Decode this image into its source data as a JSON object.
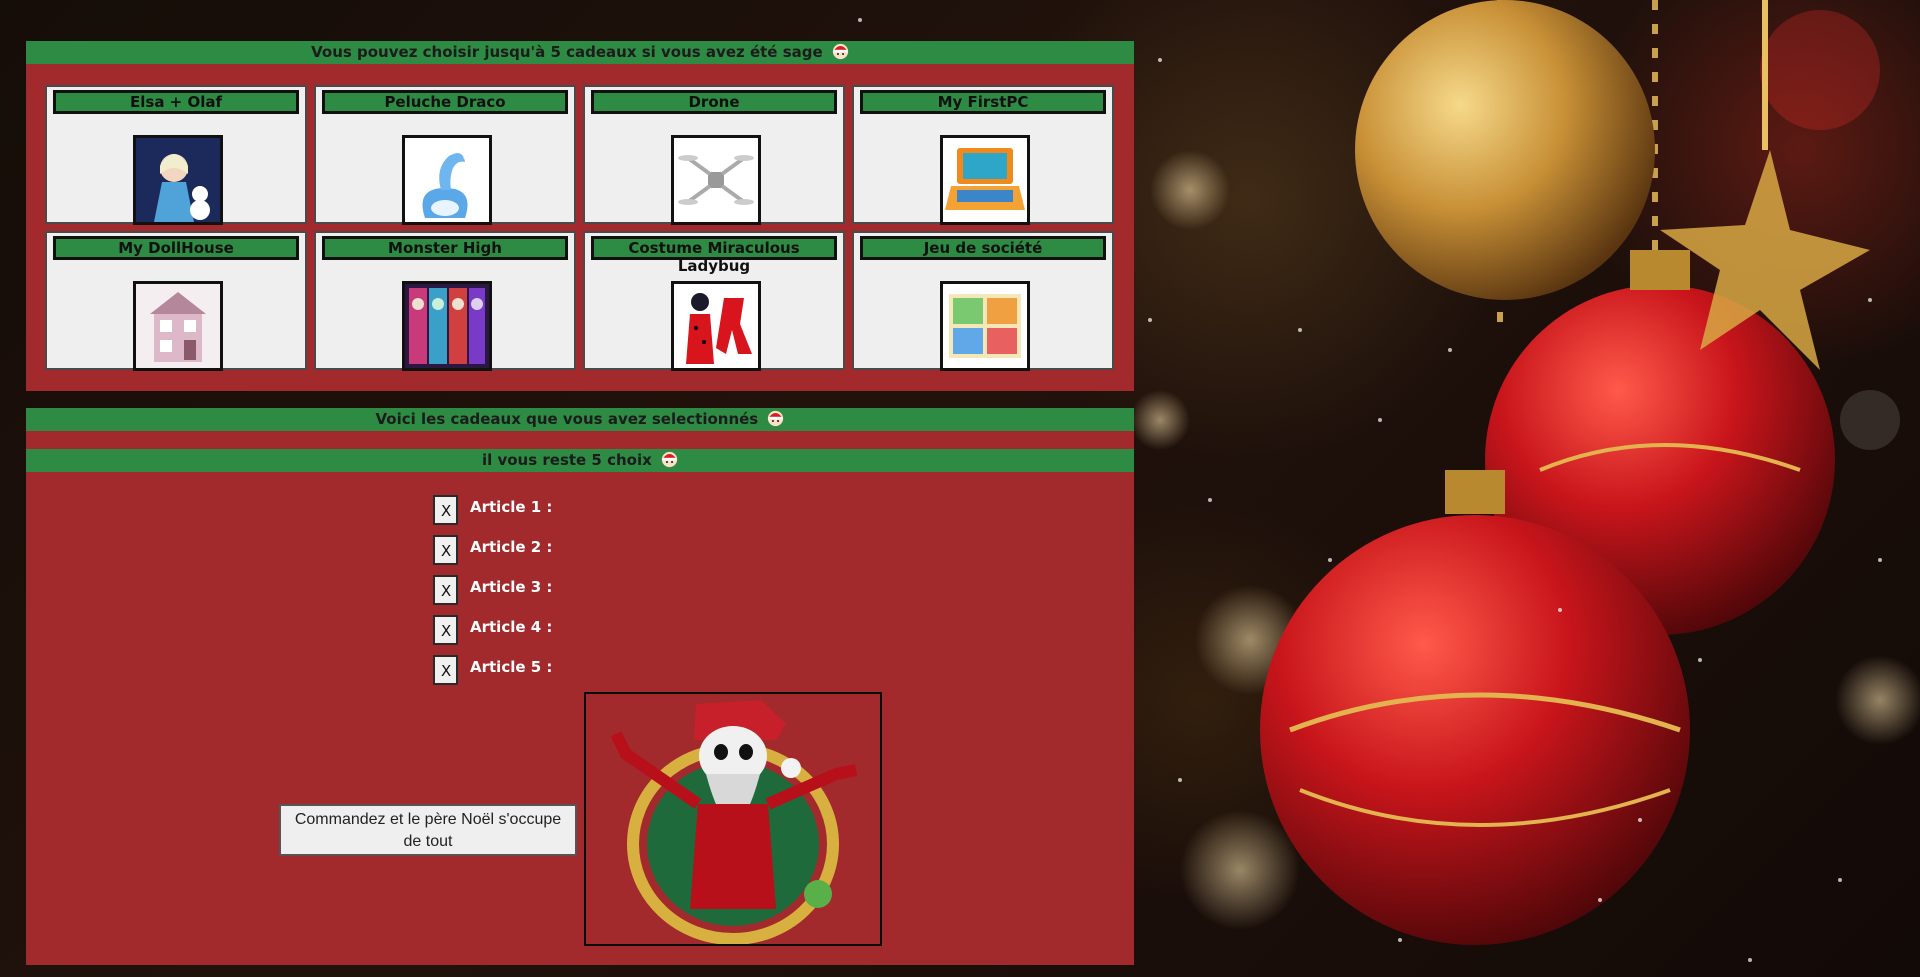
{
  "header_top": {
    "text": "Vous pouvez choisir jusqu'à 5 cadeaux si vous avez été sage"
  },
  "gifts": [
    {
      "label": "Elsa + Olaf"
    },
    {
      "label": "Peluche Draco"
    },
    {
      "label": "Drone"
    },
    {
      "label": "My FirstPC"
    },
    {
      "label": "My DollHouse"
    },
    {
      "label": "Monster High"
    },
    {
      "label": "Costume Miraculous Ladybug"
    },
    {
      "label": "Jeu de société"
    }
  ],
  "selection": {
    "header": "Voici les cadeaux que vous avez selectionnés",
    "remaining": "il vous reste 5 choix",
    "remove_label": "X",
    "articles": [
      {
        "label": "Article 1 :"
      },
      {
        "label": "Article 2 :"
      },
      {
        "label": "Article 3 :"
      },
      {
        "label": "Article 4 :"
      },
      {
        "label": "Article 5 :"
      }
    ]
  },
  "order_button": {
    "label": "Commandez et le père Noël s'occupe de tout"
  },
  "icons": {
    "header_emoji": "santa-hat-icon"
  },
  "colors": {
    "panel_red": "#a2292c",
    "bar_green": "#2e8b43",
    "card_bg": "#efefef"
  }
}
